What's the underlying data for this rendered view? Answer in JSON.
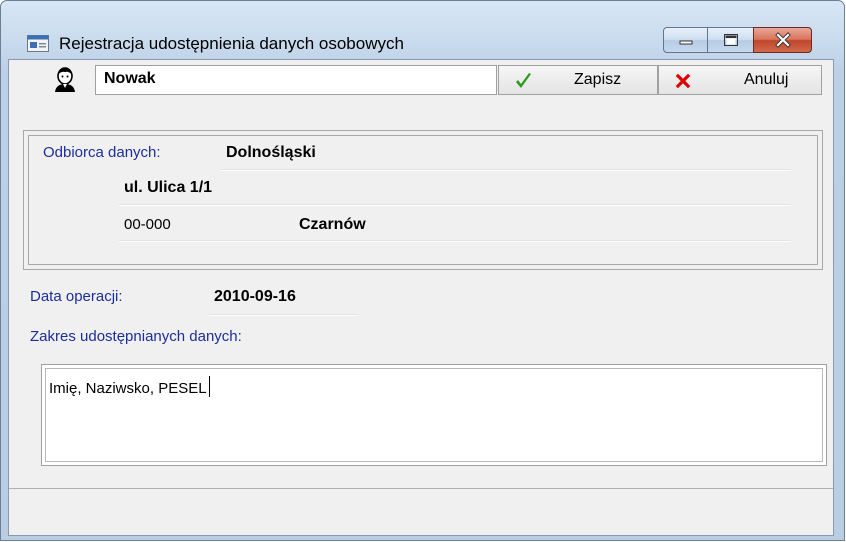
{
  "window": {
    "title": "Rejestracja udostępnienia danych osobowych"
  },
  "toolbar": {
    "surname_value": "Nowak",
    "save_label": "Zapisz",
    "cancel_label": "Anuluj"
  },
  "recipient": {
    "label": "Odbiorca danych:",
    "name": "Dolnośląski",
    "street": "ul. Ulica 1/1",
    "postal_code": "00-000",
    "city": "Czarnów"
  },
  "operation": {
    "date_label": "Data operacji:",
    "date_value": "2010-09-16",
    "scope_label": "Zakres udostępnianych danych:",
    "scope_value": "Imię, Naziwsko, PESEL"
  },
  "colors": {
    "label_blue": "#1c2e99",
    "save_check": "#2e9b1e",
    "cancel_x": "#e00000"
  },
  "icons": {
    "app": "form-icon",
    "person": "person-icon",
    "save": "checkmark-icon",
    "cancel": "x-icon"
  }
}
